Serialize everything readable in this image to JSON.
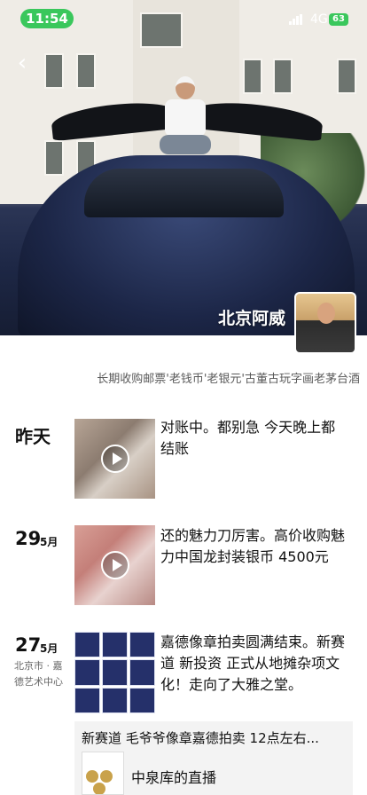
{
  "status": {
    "time": "11:54",
    "network": "4G",
    "battery": "63"
  },
  "profile": {
    "name": "北京阿威",
    "signature": "长期收购邮票'老钱币'老银元'古董古玩字画老茅台酒"
  },
  "posts": [
    {
      "day": "昨天",
      "text": "对账中。都别急 今天晚上都结账"
    },
    {
      "day": "29",
      "month": "5月",
      "text": "还的魅力刀厉害。高价收购魅力中国龙封装银币 4500元"
    },
    {
      "day": "27",
      "month": "5月",
      "location": "北京市 · 嘉德艺术中心",
      "text": "嘉德像章拍卖圆满结束。新赛道 新投资 正式从地摊杂项文化！走向了大雅之堂。"
    }
  ],
  "share": {
    "title": "新赛道 毛爷爷像章嘉德拍卖 12点左右...",
    "subtitle": "中泉库的直播"
  },
  "colors": {
    "status_green": "#3ac75c"
  }
}
